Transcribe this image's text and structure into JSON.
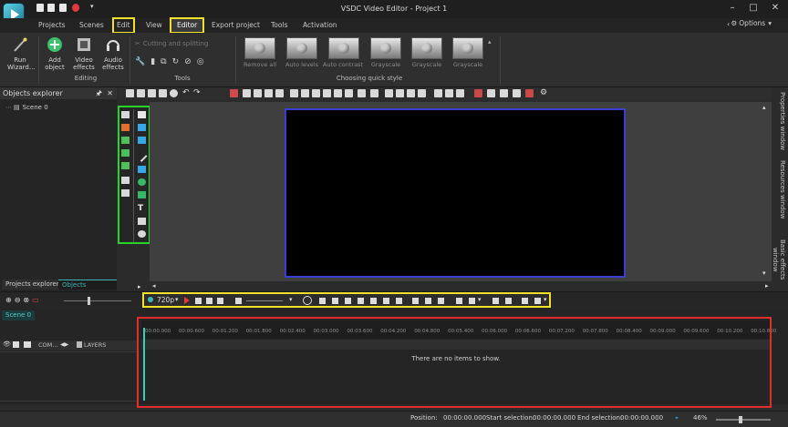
{
  "app": {
    "title": "VSDC Video Editor - Project 1"
  },
  "menu": {
    "items": [
      "Projects",
      "Scenes",
      "Edit",
      "View",
      "Editor",
      "Export project",
      "Tools",
      "Activation"
    ],
    "options_label": "Options"
  },
  "ribbon": {
    "run_wizard": "Run Wizard...",
    "add_object": "Add object",
    "video_effects": "Video effects",
    "audio_effects": "Audio effects",
    "editing_group": "Editing",
    "cutting_label": "Cutting and splitting",
    "tools_group": "Tools",
    "quick_styles": [
      "Remove all",
      "Auto levels",
      "Auto contrast",
      "Grayscale",
      "Grayscale",
      "Grayscale"
    ],
    "quick_style_group": "Choosing quick style"
  },
  "explorer": {
    "title": "Objects explorer",
    "scene_node": "Scene 0",
    "tab_projects": "Projects explorer",
    "tab_objects": "Objects explorer"
  },
  "right_panels": [
    "Properties window",
    "Resources window",
    "Basic effects window"
  ],
  "playback": {
    "resolution": "720p"
  },
  "timeline": {
    "scene_tab": "Scene 0",
    "com_label": "COM...",
    "layers_label": "LAYERS",
    "ticks": [
      "00:00.000",
      "00:00.600",
      "00:01.200",
      "00:01.800",
      "00:02.400",
      "00:03.000",
      "00:03.600",
      "00:04.200",
      "00:04.800",
      "00:05.400",
      "00:06.000",
      "00:06.600",
      "00:07.200",
      "00:07.800",
      "00:08.400",
      "00:09.000",
      "00:09.600",
      "00:10.200",
      "00:10.800"
    ],
    "empty_message": "There are no items to show."
  },
  "status": {
    "position_label": "Position:",
    "position_value": "00:00:00.000",
    "start_label": "Start selection:",
    "start_value": "00:00:00.000",
    "end_label": "End selection:",
    "end_value": "00:00:00.000",
    "zoom": "46%"
  },
  "colors": {
    "highlight_yellow": "#f2e12a",
    "highlight_green": "#27d52a",
    "highlight_red": "#e32c2c",
    "frame_border": "#3b3fd0"
  }
}
